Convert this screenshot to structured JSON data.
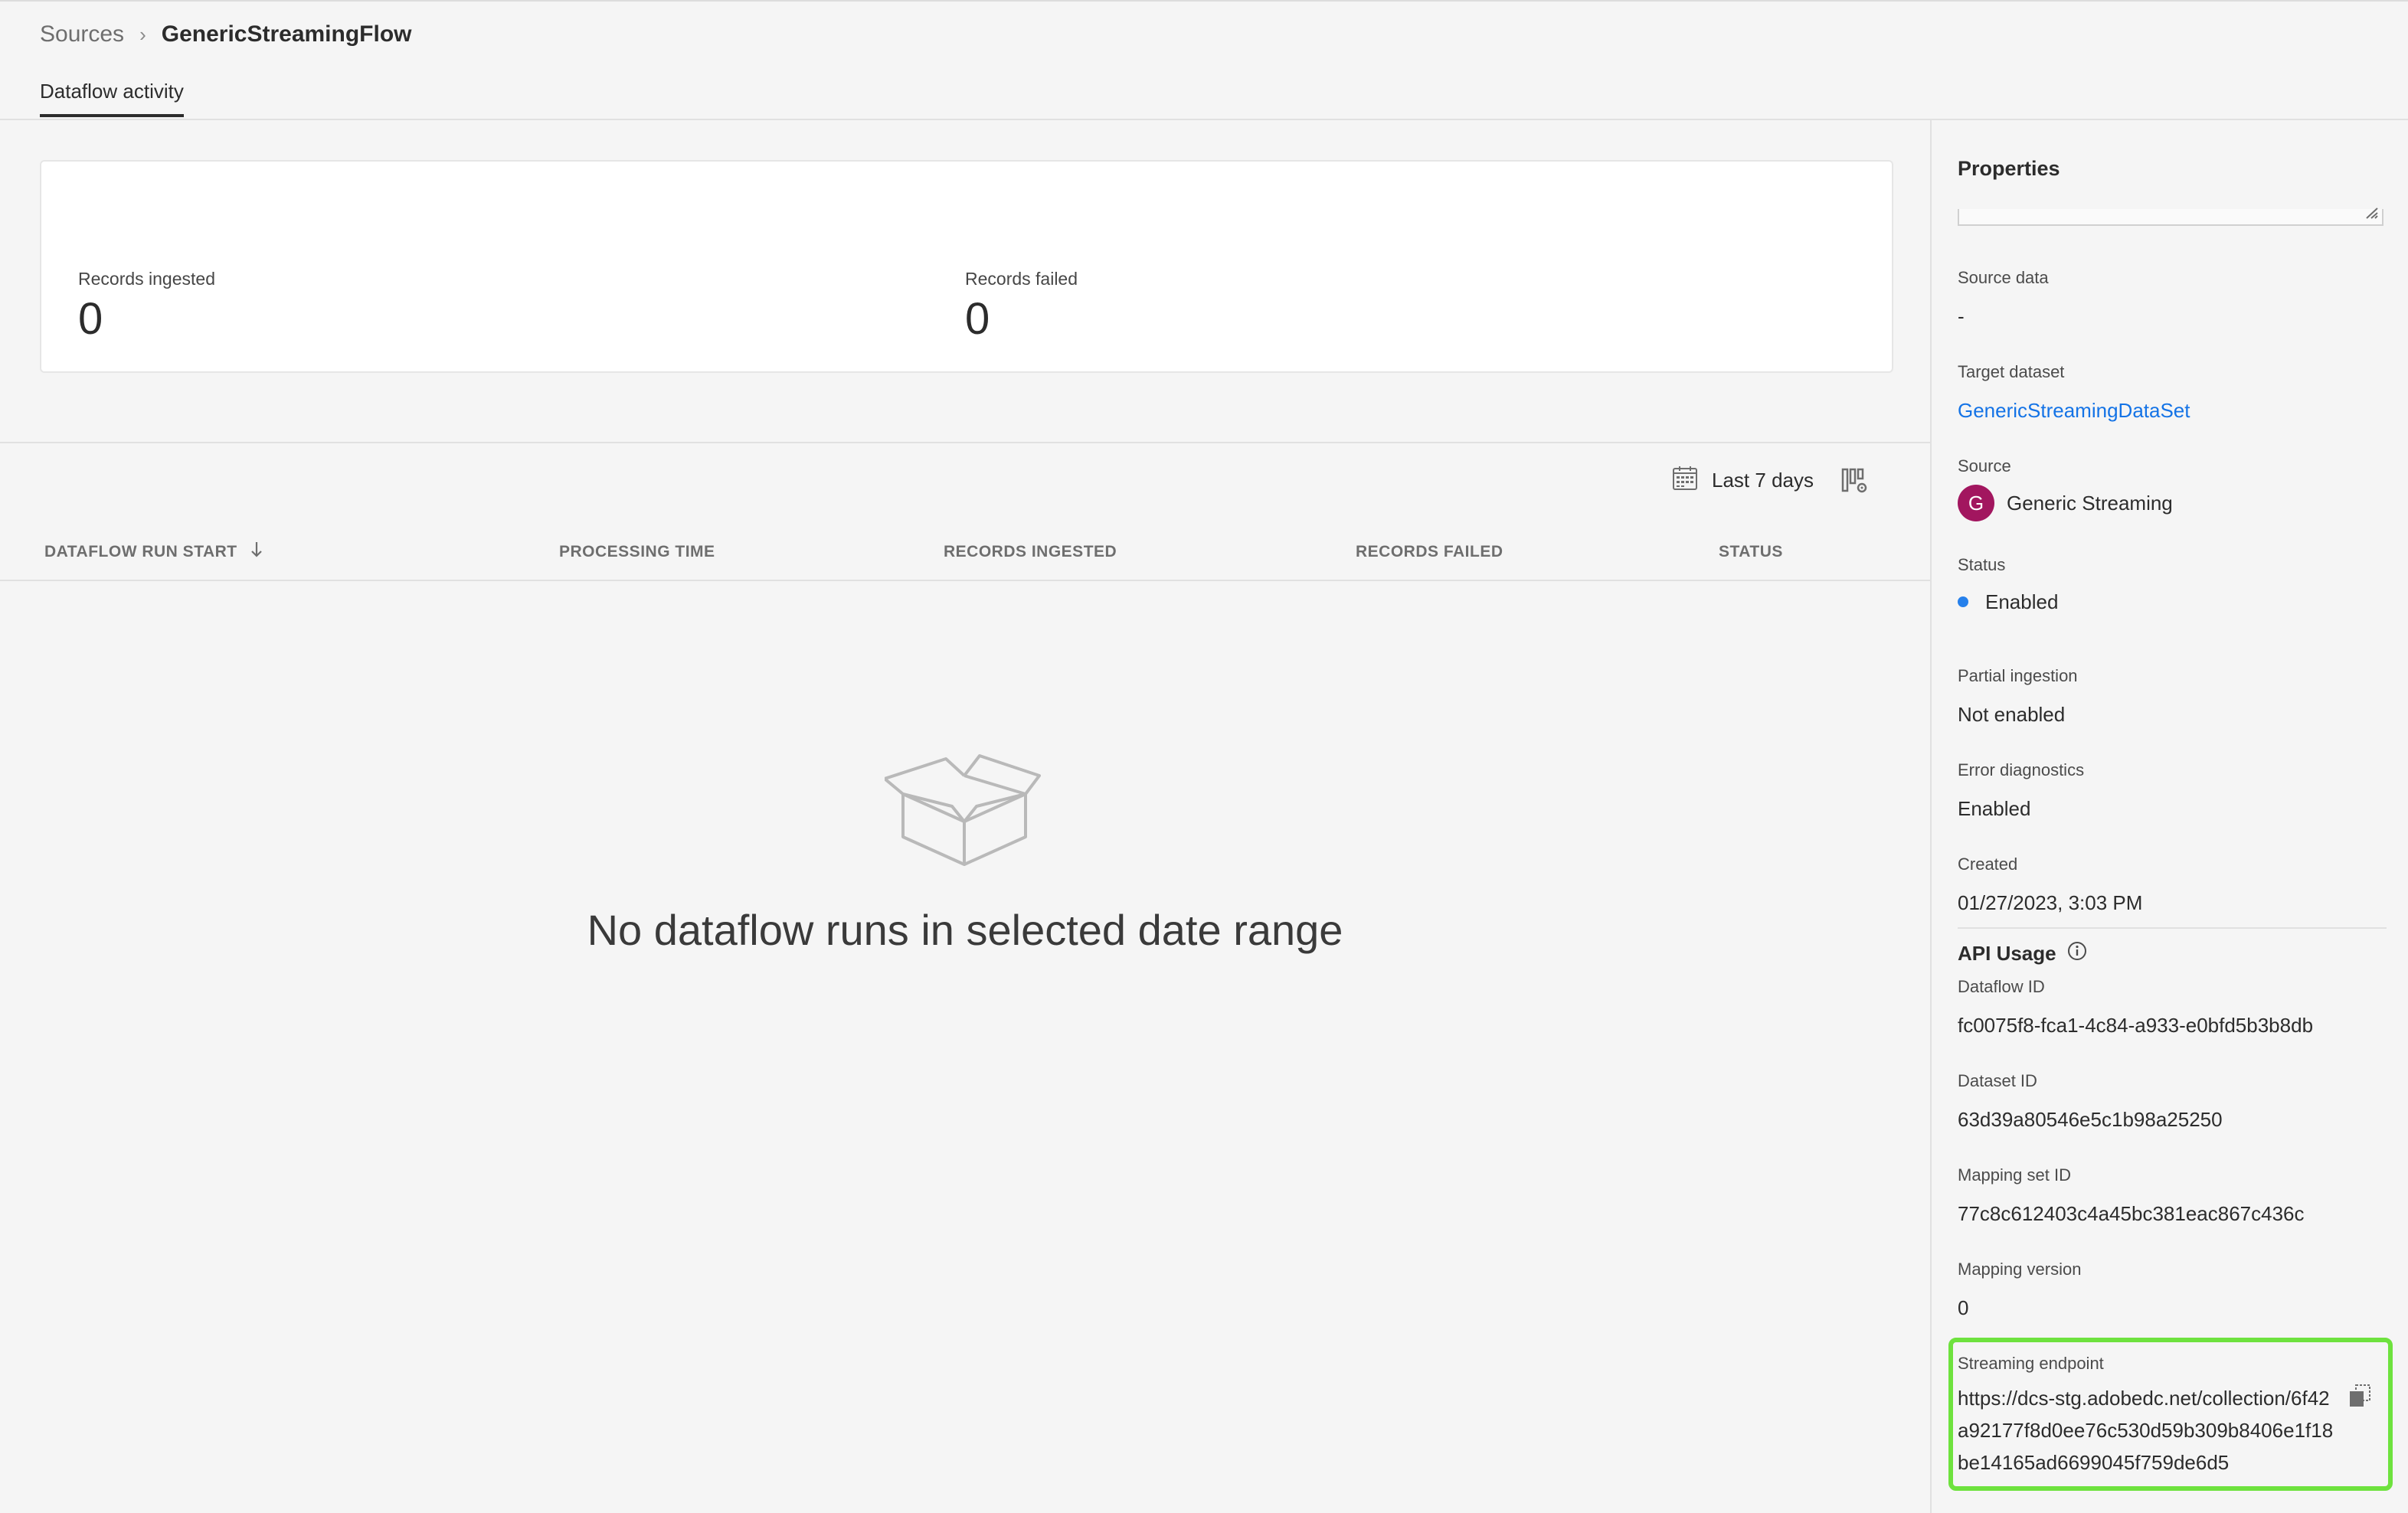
{
  "breadcrumb": {
    "parent": "Sources",
    "current": "GenericStreamingFlow"
  },
  "tabs": [
    {
      "label": "Dataflow activity",
      "active": true
    }
  ],
  "metrics": {
    "records_ingested_label": "Records ingested",
    "records_ingested_value": "0",
    "records_failed_label": "Records failed",
    "records_failed_value": "0"
  },
  "toolbar": {
    "date_range": "Last 7 days"
  },
  "table": {
    "columns": [
      {
        "label": "DATAFLOW RUN START",
        "sorted": "descending"
      },
      {
        "label": "PROCESSING TIME"
      },
      {
        "label": "RECORDS INGESTED"
      },
      {
        "label": "RECORDS FAILED"
      },
      {
        "label": "STATUS"
      }
    ],
    "rows": []
  },
  "empty_state": {
    "message": "No dataflow runs in selected date range",
    "icon": "open-box-icon"
  },
  "properties": {
    "title": "Properties",
    "source_data": {
      "label": "Source data",
      "value": "-"
    },
    "target_dataset": {
      "label": "Target dataset",
      "value": "GenericStreamingDataSet"
    },
    "source": {
      "label": "Source",
      "avatar_letter": "G",
      "value": "Generic Streaming"
    },
    "status": {
      "label": "Status",
      "value": "Enabled"
    },
    "partial_ingestion": {
      "label": "Partial ingestion",
      "value": "Not enabled"
    },
    "error_diagnostics": {
      "label": "Error diagnostics",
      "value": "Enabled"
    },
    "created": {
      "label": "Created",
      "value": "01/27/2023, 3:03 PM"
    },
    "api_usage": {
      "heading": "API Usage",
      "dataflow_id": {
        "label": "Dataflow ID",
        "value": "fc0075f8-fca1-4c84-a933-e0bfd5b3b8db"
      },
      "dataset_id": {
        "label": "Dataset ID",
        "value": "63d39a80546e5c1b98a25250"
      },
      "mapping_set_id": {
        "label": "Mapping set ID",
        "value": "77c8c612403c4a45bc381eac867c436c"
      },
      "mapping_version": {
        "label": "Mapping version",
        "value": "0"
      },
      "streaming_endpoint": {
        "label": "Streaming endpoint",
        "value": "https://dcs-stg.adobedc.net/collection/6f42a92177f8d0ee76c530d59b309b8406e1f18be14165ad6699045f759de6d5"
      }
    }
  },
  "colors": {
    "accent_link": "#1473e6",
    "status_enabled": "#2680eb",
    "avatar_bg": "#a2165f",
    "highlight": "#6ee23e"
  }
}
